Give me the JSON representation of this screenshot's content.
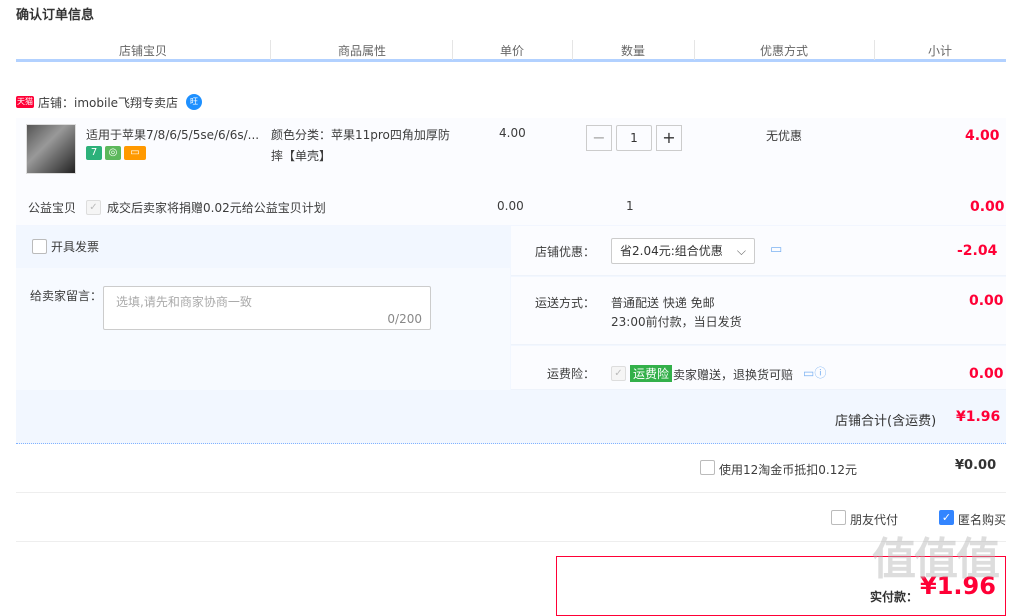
{
  "page": {
    "title": "确认订单信息"
  },
  "table_header": {
    "columns": [
      "店铺宝贝",
      "商品属性",
      "单价",
      "数量",
      "优惠方式",
      "小计"
    ]
  },
  "shop": {
    "tag": "天猫",
    "name": "店铺：imobile飞翔专卖店",
    "chat_badge": "旺"
  },
  "item": {
    "title": "适用于苹果7/8/6/5/5se/6/6s/...",
    "badges": [
      "7",
      "◎",
      "▭"
    ],
    "attr_line1": "颜色分类：苹果11pro四角加厚防",
    "attr_line2": "摔【单壳】",
    "price": "4.00",
    "qty_minus": "−",
    "qty": "1",
    "qty_plus": "+",
    "discount": "无优惠",
    "subtotal": "4.00"
  },
  "charity": {
    "label": "公益宝贝",
    "text": "成交后卖家将捐赠0.02元给公益宝贝计划",
    "price": "0.00",
    "qty": "1",
    "subtotal": "0.00"
  },
  "invoice": {
    "label": "开具发票"
  },
  "message": {
    "label": "给卖家留言：",
    "placeholder": "选填,请先和商家协商一致",
    "counter": "0/200"
  },
  "shop_discount": {
    "label": "店铺优惠：",
    "value": "省2.04元:组合优惠",
    "amount": "-2.04"
  },
  "shipping": {
    "label": "运送方式：",
    "line1": "普通配送 快递 免邮",
    "line2": "23:00前付款，当日发货",
    "amount": "0.00"
  },
  "insurance": {
    "label": "运费险：",
    "tag": "运费险",
    "text": "卖家赠送，退换货可赔",
    "amount": "0.00"
  },
  "shop_total": {
    "label": "店铺合计(含运费)",
    "amount": "¥1.96"
  },
  "coins": {
    "label": "使用12淘金币抵扣0.12元",
    "amount": "¥0.00"
  },
  "friend_pay": {
    "label": "朋友代付"
  },
  "anonymous": {
    "label": "匿名购买"
  },
  "pay": {
    "label": "实付款：",
    "amount": "¥1.96"
  },
  "watermark": "值值值",
  "colors": {
    "accent_red": "#ff0036",
    "header_blue": "#b2d1ff",
    "panel_bg": "#f2f7ff"
  }
}
